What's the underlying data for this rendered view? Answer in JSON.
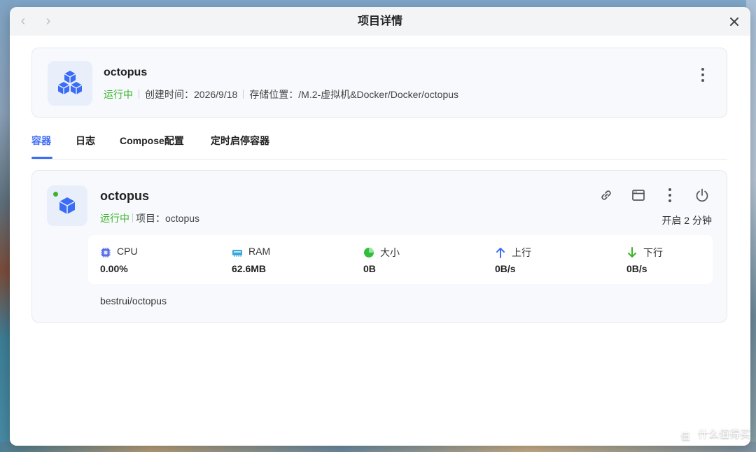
{
  "window": {
    "title": "项目详情"
  },
  "project": {
    "name": "octopus",
    "status": "运行中",
    "created_label": "创建时间：",
    "created": "2026/9/18",
    "storage_label": "存储位置：",
    "storage": "/M.2-虚拟机&Docker/Docker/octopus"
  },
  "tabs": [
    {
      "label": "容器",
      "active": true
    },
    {
      "label": "日志"
    },
    {
      "label": "Compose配置"
    },
    {
      "label": "定时启停容器"
    }
  ],
  "container": {
    "name": "octopus",
    "status": "运行中",
    "project_label": "项目：",
    "project": "octopus",
    "uptime": "开启 2 分钟",
    "image": "bestrui/octopus",
    "stats": [
      {
        "icon": "cpu-icon",
        "label": "CPU",
        "value": "0.00%"
      },
      {
        "icon": "ram-icon",
        "label": "RAM",
        "value": "62.6MB"
      },
      {
        "icon": "pie-chart-icon",
        "label": "大小",
        "value": "0B"
      },
      {
        "icon": "arrow-up-icon",
        "label": "上行",
        "value": "0B/s"
      },
      {
        "icon": "arrow-down-icon",
        "label": "下行",
        "value": "0B/s"
      }
    ]
  },
  "watermark": {
    "logo": "值",
    "text": "什么值得买"
  },
  "colors": {
    "accent": "#3b6cf6",
    "running": "#3db32a",
    "upload": "#3b6cf6",
    "download": "#3db32a"
  }
}
